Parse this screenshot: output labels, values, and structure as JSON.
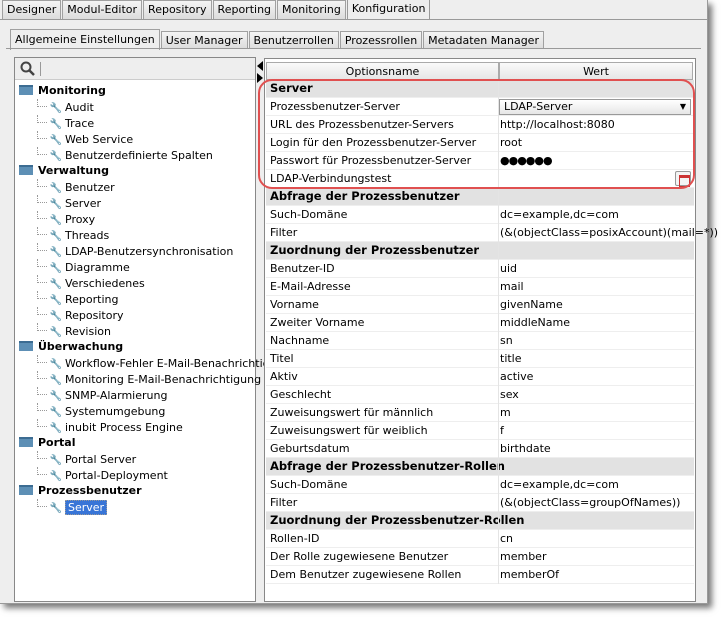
{
  "main_tabs": [
    "Designer",
    "Modul-Editor",
    "Repository",
    "Reporting",
    "Monitoring",
    "Konfiguration"
  ],
  "active_main_tab": "Konfiguration",
  "sub_tabs": [
    "Allgemeine Einstellungen",
    "User Manager",
    "Benutzerrollen",
    "Prozessrollen",
    "Metadaten Manager"
  ],
  "active_sub_tab": "Allgemeine Einstellungen",
  "tree": [
    {
      "group": "Monitoring",
      "items": [
        "Audit",
        "Trace",
        "Web Service",
        "Benutzerdefinierte Spalten"
      ]
    },
    {
      "group": "Verwaltung",
      "items": [
        "Benutzer",
        "Server",
        "Proxy",
        "Threads",
        "LDAP-Benutzersynchronisation",
        "Diagramme",
        "Verschiedenes",
        "Reporting",
        "Repository",
        "Revision"
      ]
    },
    {
      "group": "Überwachung",
      "items": [
        "Workflow-Fehler E-Mail-Benachrichtigung",
        "Monitoring E-Mail-Benachrichtigung",
        "SNMP-Alarmierung",
        "Systemumgebung",
        "inubit Process Engine"
      ]
    },
    {
      "group": "Portal",
      "items": [
        "Portal Server",
        "Portal-Deployment"
      ]
    },
    {
      "group": "Prozessbenutzer",
      "items": [
        "Server"
      ]
    }
  ],
  "selected_tree_item": "Server",
  "table": {
    "headers": [
      "Optionsname",
      "Wert"
    ],
    "rows": [
      {
        "section": "Server"
      },
      {
        "k": "Prozessbenutzer-Server",
        "v": "LDAP-Server",
        "type": "dropdown"
      },
      {
        "k": "URL des Prozessbenutzer-Servers",
        "v": "http://localhost:8080"
      },
      {
        "k": "Login für den Prozessbenutzer-Server",
        "v": "root"
      },
      {
        "k": "Passwort für Prozessbenutzer-Server",
        "v": "●●●●●●"
      },
      {
        "k": "LDAP-Verbindungstest",
        "v": "",
        "type": "button"
      },
      {
        "section": "Abfrage der Prozessbenutzer"
      },
      {
        "k": "Such-Domäne",
        "v": "dc=example,dc=com"
      },
      {
        "k": "Filter",
        "v": "(&(objectClass=posixAccount)(mail=*))"
      },
      {
        "section": "Zuordnung der Prozessbenutzer"
      },
      {
        "k": "Benutzer-ID",
        "v": "uid"
      },
      {
        "k": "E-Mail-Adresse",
        "v": "mail"
      },
      {
        "k": "Vorname",
        "v": "givenName"
      },
      {
        "k": "Zweiter Vorname",
        "v": "middleName"
      },
      {
        "k": "Nachname",
        "v": "sn"
      },
      {
        "k": "Titel",
        "v": "title"
      },
      {
        "k": "Aktiv",
        "v": "active"
      },
      {
        "k": "Geschlecht",
        "v": "sex"
      },
      {
        "k": "Zuweisungswert für männlich",
        "v": "m"
      },
      {
        "k": "Zuweisungswert für weiblich",
        "v": "f"
      },
      {
        "k": "Geburtsdatum",
        "v": "birthdate"
      },
      {
        "section": "Abfrage der Prozessbenutzer-Rollen"
      },
      {
        "k": "Such-Domäne",
        "v": "dc=example,dc=com"
      },
      {
        "k": "Filter",
        "v": "(&(objectClass=groupOfNames))"
      },
      {
        "section": "Zuordnung der Prozessbenutzer-Rollen"
      },
      {
        "k": "Rollen-ID",
        "v": "cn"
      },
      {
        "k": "Der Rolle zugewiesene Benutzer",
        "v": "member"
      },
      {
        "k": "Dem Benutzer zugewiesene Rollen",
        "v": "memberOf"
      }
    ]
  },
  "colors": {
    "highlight": "#e05050",
    "selection": "#3875d7",
    "folder": "#5d8fb5"
  }
}
